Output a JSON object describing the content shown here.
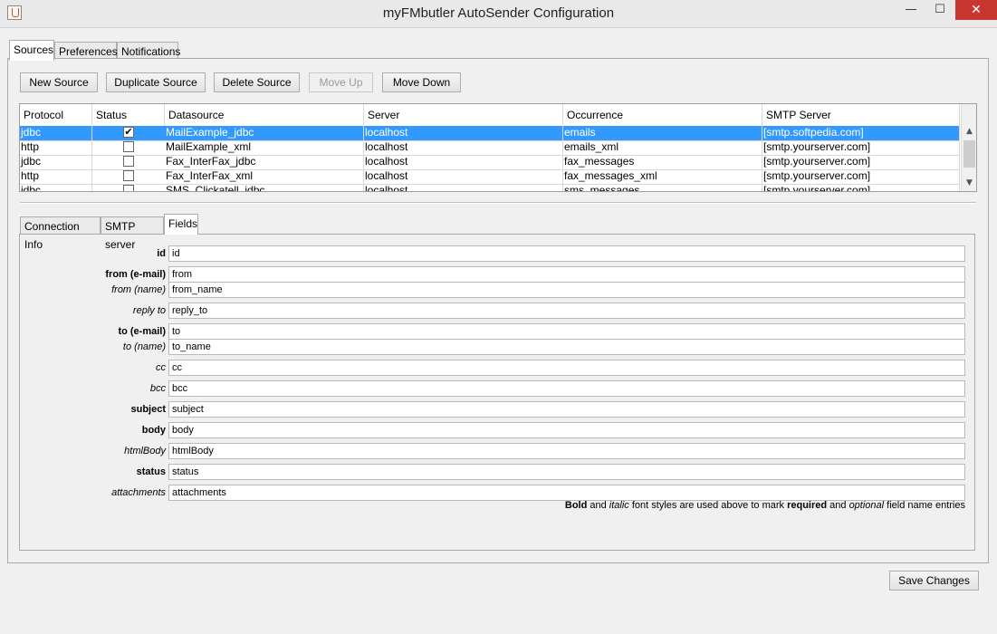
{
  "window": {
    "title": "myFMbutler AutoSender Configuration",
    "minimize_glyph": "—",
    "maximize_glyph": "☐",
    "close_glyph": "✕"
  },
  "main_tabs": [
    "Sources",
    "Preferences",
    "Notifications"
  ],
  "toolbar": {
    "new_source": "New Source",
    "duplicate_source": "Duplicate Source",
    "delete_source": "Delete Source",
    "move_up": "Move Up",
    "move_down": "Move Down"
  },
  "table": {
    "columns": [
      "Protocol",
      "Status",
      "Datasource",
      "Server",
      "Occurrence",
      "SMTP Server"
    ],
    "rows": [
      {
        "protocol": "jdbc",
        "status": "✔",
        "datasource": "MailExample_jdbc",
        "server": "localhost",
        "occurrence": "emails",
        "smtp": "[smtp.softpedia.com]",
        "selected": true
      },
      {
        "protocol": "http",
        "status": "",
        "datasource": "MailExample_xml",
        "server": "localhost",
        "occurrence": "emails_xml",
        "smtp": "[smtp.yourserver.com]",
        "selected": false
      },
      {
        "protocol": "jdbc",
        "status": "",
        "datasource": "Fax_InterFax_jdbc",
        "server": "localhost",
        "occurrence": "fax_messages",
        "smtp": "[smtp.yourserver.com]",
        "selected": false
      },
      {
        "protocol": "http",
        "status": "",
        "datasource": "Fax_InterFax_xml",
        "server": "localhost",
        "occurrence": "fax_messages_xml",
        "smtp": "[smtp.yourserver.com]",
        "selected": false
      },
      {
        "protocol": "jdbc",
        "status": "",
        "datasource": "SMS_Clickatell_jdbc",
        "server": "localhost",
        "occurrence": "sms_messages",
        "smtp": "[smtp.yourserver.com]",
        "selected": false
      }
    ]
  },
  "sub_tabs": [
    "Connection Info",
    "SMTP server",
    "Fields"
  ],
  "fields": [
    {
      "label": "id",
      "value": "id",
      "style": "required"
    },
    {
      "label": "from (e-mail)",
      "value": "from",
      "style": "required"
    },
    {
      "label": "from (name)",
      "value": "from_name",
      "style": "optional"
    },
    {
      "label": "reply to",
      "value": "reply_to",
      "style": "optional"
    },
    {
      "label": "to (e-mail)",
      "value": "to",
      "style": "required"
    },
    {
      "label": "to (name)",
      "value": "to_name",
      "style": "optional"
    },
    {
      "label": "cc",
      "value": "cc",
      "style": "optional"
    },
    {
      "label": "bcc",
      "value": "bcc",
      "style": "optional"
    },
    {
      "label": "subject",
      "value": "subject",
      "style": "required"
    },
    {
      "label": "body",
      "value": "body",
      "style": "required"
    },
    {
      "label": "htmlBody",
      "value": "htmlBody",
      "style": "optional"
    },
    {
      "label": "status",
      "value": "status",
      "style": "required"
    },
    {
      "label": "attachments",
      "value": "attachments",
      "style": "optional"
    }
  ],
  "note": {
    "bold": "Bold",
    "t1": " and ",
    "italic": "italic",
    "t2": " font styles are used above to mark ",
    "required": "required",
    "t3": " and ",
    "optional": "optional",
    "t4": " field name entries"
  },
  "save_changes": "Save Changes",
  "colors": {
    "selection": "#3399ff",
    "close_button": "#c7372f"
  }
}
